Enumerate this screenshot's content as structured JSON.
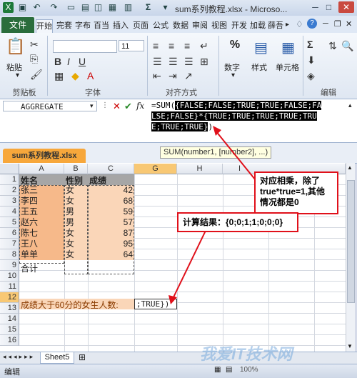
{
  "window": {
    "title": "sum系列教程.xlsx - Microso...",
    "minimize": "─",
    "maximize": "□",
    "close": "✕"
  },
  "ribbon": {
    "file_tab": "文件",
    "tabs": [
      "开始",
      "完套",
      "字布",
      "百当",
      "插入",
      "页面",
      "公式",
      "数据",
      "审阅",
      "视图",
      "开发",
      "加载",
      "薛吾"
    ],
    "groups": {
      "clipboard": "剪贴板",
      "font": "字体",
      "alignment": "对齐方式",
      "edit": "编辑"
    },
    "paste": "粘贴",
    "font_size": "11",
    "number": "数字",
    "styles": "样式",
    "cells": "单元格",
    "percent": "%"
  },
  "formula_bar": {
    "name_box": "AGGREGATE",
    "formula_prefix": "=SUM(",
    "formula_highlight_1": "{FALSE;FALSE;TRUE;TRUE;FALSE;FALSE;FALSE}",
    "formula_mid": "*",
    "formula_highlight_2": "{TRUE;TRUE;TRUE;TRUE;TRUE;TRUE;TRUE}",
    "formula_suffix": ")"
  },
  "workbook": {
    "tab_name": "sum系列教程.xlsx",
    "tooltip_fn": "SUM(number1, [number2], ...)"
  },
  "grid": {
    "columns": [
      "A",
      "B",
      "C",
      "G",
      "H",
      "I"
    ],
    "rows": [
      "1",
      "2",
      "3",
      "4",
      "5",
      "6",
      "7",
      "8",
      "9",
      "10",
      "11",
      "12",
      "13",
      "14",
      "15",
      "16",
      "17"
    ],
    "header": [
      "姓名",
      "性别",
      "成绩"
    ],
    "data": [
      [
        "张三",
        "女",
        "42"
      ],
      [
        "李四",
        "女",
        "68"
      ],
      [
        "王五",
        "男",
        "59"
      ],
      [
        "赵六",
        "男",
        "57"
      ],
      [
        "陈七",
        "女",
        "87"
      ],
      [
        "王八",
        "女",
        "95"
      ],
      [
        "单单",
        "女",
        "64"
      ]
    ],
    "total_label": "合计",
    "row12_label": "成绩大于60分的女生人数:",
    "row12_edit": ";TRUE})"
  },
  "sheets": {
    "active": "Sheet5"
  },
  "status": {
    "mode": "编辑",
    "zoom": "100%"
  },
  "annotations": {
    "note1": "对应相乘，除了true*true=1,其他情况都是0",
    "note2": "计算结果：{0;0;1;1;0;0;0}"
  },
  "watermark": "我爱IT技术网"
}
